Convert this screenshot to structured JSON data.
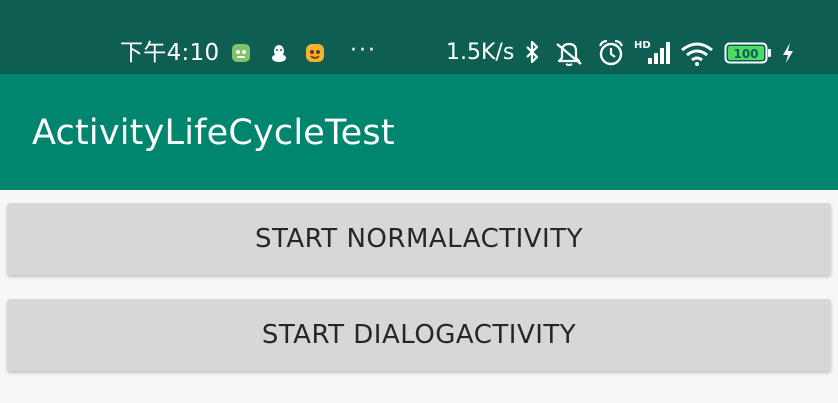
{
  "status_bar": {
    "time": "下午4:10",
    "notification_icons": [
      "app-icon-green",
      "qq-penguin-icon",
      "app-icon-yellow"
    ],
    "more": "···",
    "network_speed": "1.5K/s",
    "battery_level": "100",
    "network_type": "HD",
    "colors": {
      "background": "#0e5f52",
      "text": "#ffffff"
    }
  },
  "app_bar": {
    "title": "ActivityLifeCycleTest",
    "background": "#00856f"
  },
  "buttons": {
    "normal": "START NORMALACTIVITY",
    "dialog": "START DIALOGACTIVITY"
  }
}
